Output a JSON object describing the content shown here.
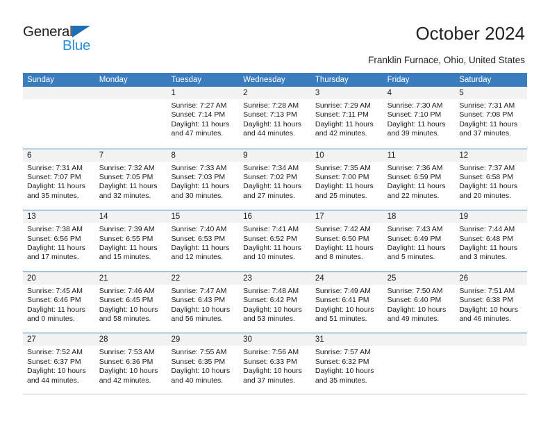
{
  "logo": {
    "general_text": "General",
    "blue_text": "Blue",
    "triangle_color": "#1c6fb5",
    "blue_color": "#2b8fd8"
  },
  "header": {
    "title": "October 2024",
    "subtitle": "Franklin Furnace, Ohio, United States"
  },
  "theme": {
    "header_blue": "#3a7cbe",
    "day_strip_gray": "#f2f2f2",
    "text_color": "#1a1a1a"
  },
  "weekdays": [
    "Sunday",
    "Monday",
    "Tuesday",
    "Wednesday",
    "Thursday",
    "Friday",
    "Saturday"
  ],
  "weeks": [
    [
      {
        "day": "",
        "lines": []
      },
      {
        "day": "",
        "lines": []
      },
      {
        "day": "1",
        "lines": [
          "Sunrise: 7:27 AM",
          "Sunset: 7:14 PM",
          "Daylight: 11 hours",
          "and 47 minutes."
        ]
      },
      {
        "day": "2",
        "lines": [
          "Sunrise: 7:28 AM",
          "Sunset: 7:13 PM",
          "Daylight: 11 hours",
          "and 44 minutes."
        ]
      },
      {
        "day": "3",
        "lines": [
          "Sunrise: 7:29 AM",
          "Sunset: 7:11 PM",
          "Daylight: 11 hours",
          "and 42 minutes."
        ]
      },
      {
        "day": "4",
        "lines": [
          "Sunrise: 7:30 AM",
          "Sunset: 7:10 PM",
          "Daylight: 11 hours",
          "and 39 minutes."
        ]
      },
      {
        "day": "5",
        "lines": [
          "Sunrise: 7:31 AM",
          "Sunset: 7:08 PM",
          "Daylight: 11 hours",
          "and 37 minutes."
        ]
      }
    ],
    [
      {
        "day": "6",
        "lines": [
          "Sunrise: 7:31 AM",
          "Sunset: 7:07 PM",
          "Daylight: 11 hours",
          "and 35 minutes."
        ]
      },
      {
        "day": "7",
        "lines": [
          "Sunrise: 7:32 AM",
          "Sunset: 7:05 PM",
          "Daylight: 11 hours",
          "and 32 minutes."
        ]
      },
      {
        "day": "8",
        "lines": [
          "Sunrise: 7:33 AM",
          "Sunset: 7:03 PM",
          "Daylight: 11 hours",
          "and 30 minutes."
        ]
      },
      {
        "day": "9",
        "lines": [
          "Sunrise: 7:34 AM",
          "Sunset: 7:02 PM",
          "Daylight: 11 hours",
          "and 27 minutes."
        ]
      },
      {
        "day": "10",
        "lines": [
          "Sunrise: 7:35 AM",
          "Sunset: 7:00 PM",
          "Daylight: 11 hours",
          "and 25 minutes."
        ]
      },
      {
        "day": "11",
        "lines": [
          "Sunrise: 7:36 AM",
          "Sunset: 6:59 PM",
          "Daylight: 11 hours",
          "and 22 minutes."
        ]
      },
      {
        "day": "12",
        "lines": [
          "Sunrise: 7:37 AM",
          "Sunset: 6:58 PM",
          "Daylight: 11 hours",
          "and 20 minutes."
        ]
      }
    ],
    [
      {
        "day": "13",
        "lines": [
          "Sunrise: 7:38 AM",
          "Sunset: 6:56 PM",
          "Daylight: 11 hours",
          "and 17 minutes."
        ]
      },
      {
        "day": "14",
        "lines": [
          "Sunrise: 7:39 AM",
          "Sunset: 6:55 PM",
          "Daylight: 11 hours",
          "and 15 minutes."
        ]
      },
      {
        "day": "15",
        "lines": [
          "Sunrise: 7:40 AM",
          "Sunset: 6:53 PM",
          "Daylight: 11 hours",
          "and 12 minutes."
        ]
      },
      {
        "day": "16",
        "lines": [
          "Sunrise: 7:41 AM",
          "Sunset: 6:52 PM",
          "Daylight: 11 hours",
          "and 10 minutes."
        ]
      },
      {
        "day": "17",
        "lines": [
          "Sunrise: 7:42 AM",
          "Sunset: 6:50 PM",
          "Daylight: 11 hours",
          "and 8 minutes."
        ]
      },
      {
        "day": "18",
        "lines": [
          "Sunrise: 7:43 AM",
          "Sunset: 6:49 PM",
          "Daylight: 11 hours",
          "and 5 minutes."
        ]
      },
      {
        "day": "19",
        "lines": [
          "Sunrise: 7:44 AM",
          "Sunset: 6:48 PM",
          "Daylight: 11 hours",
          "and 3 minutes."
        ]
      }
    ],
    [
      {
        "day": "20",
        "lines": [
          "Sunrise: 7:45 AM",
          "Sunset: 6:46 PM",
          "Daylight: 11 hours",
          "and 0 minutes."
        ]
      },
      {
        "day": "21",
        "lines": [
          "Sunrise: 7:46 AM",
          "Sunset: 6:45 PM",
          "Daylight: 10 hours",
          "and 58 minutes."
        ]
      },
      {
        "day": "22",
        "lines": [
          "Sunrise: 7:47 AM",
          "Sunset: 6:43 PM",
          "Daylight: 10 hours",
          "and 56 minutes."
        ]
      },
      {
        "day": "23",
        "lines": [
          "Sunrise: 7:48 AM",
          "Sunset: 6:42 PM",
          "Daylight: 10 hours",
          "and 53 minutes."
        ]
      },
      {
        "day": "24",
        "lines": [
          "Sunrise: 7:49 AM",
          "Sunset: 6:41 PM",
          "Daylight: 10 hours",
          "and 51 minutes."
        ]
      },
      {
        "day": "25",
        "lines": [
          "Sunrise: 7:50 AM",
          "Sunset: 6:40 PM",
          "Daylight: 10 hours",
          "and 49 minutes."
        ]
      },
      {
        "day": "26",
        "lines": [
          "Sunrise: 7:51 AM",
          "Sunset: 6:38 PM",
          "Daylight: 10 hours",
          "and 46 minutes."
        ]
      }
    ],
    [
      {
        "day": "27",
        "lines": [
          "Sunrise: 7:52 AM",
          "Sunset: 6:37 PM",
          "Daylight: 10 hours",
          "and 44 minutes."
        ]
      },
      {
        "day": "28",
        "lines": [
          "Sunrise: 7:53 AM",
          "Sunset: 6:36 PM",
          "Daylight: 10 hours",
          "and 42 minutes."
        ]
      },
      {
        "day": "29",
        "lines": [
          "Sunrise: 7:55 AM",
          "Sunset: 6:35 PM",
          "Daylight: 10 hours",
          "and 40 minutes."
        ]
      },
      {
        "day": "30",
        "lines": [
          "Sunrise: 7:56 AM",
          "Sunset: 6:33 PM",
          "Daylight: 10 hours",
          "and 37 minutes."
        ]
      },
      {
        "day": "31",
        "lines": [
          "Sunrise: 7:57 AM",
          "Sunset: 6:32 PM",
          "Daylight: 10 hours",
          "and 35 minutes."
        ]
      },
      {
        "day": "",
        "lines": []
      },
      {
        "day": "",
        "lines": []
      }
    ]
  ]
}
